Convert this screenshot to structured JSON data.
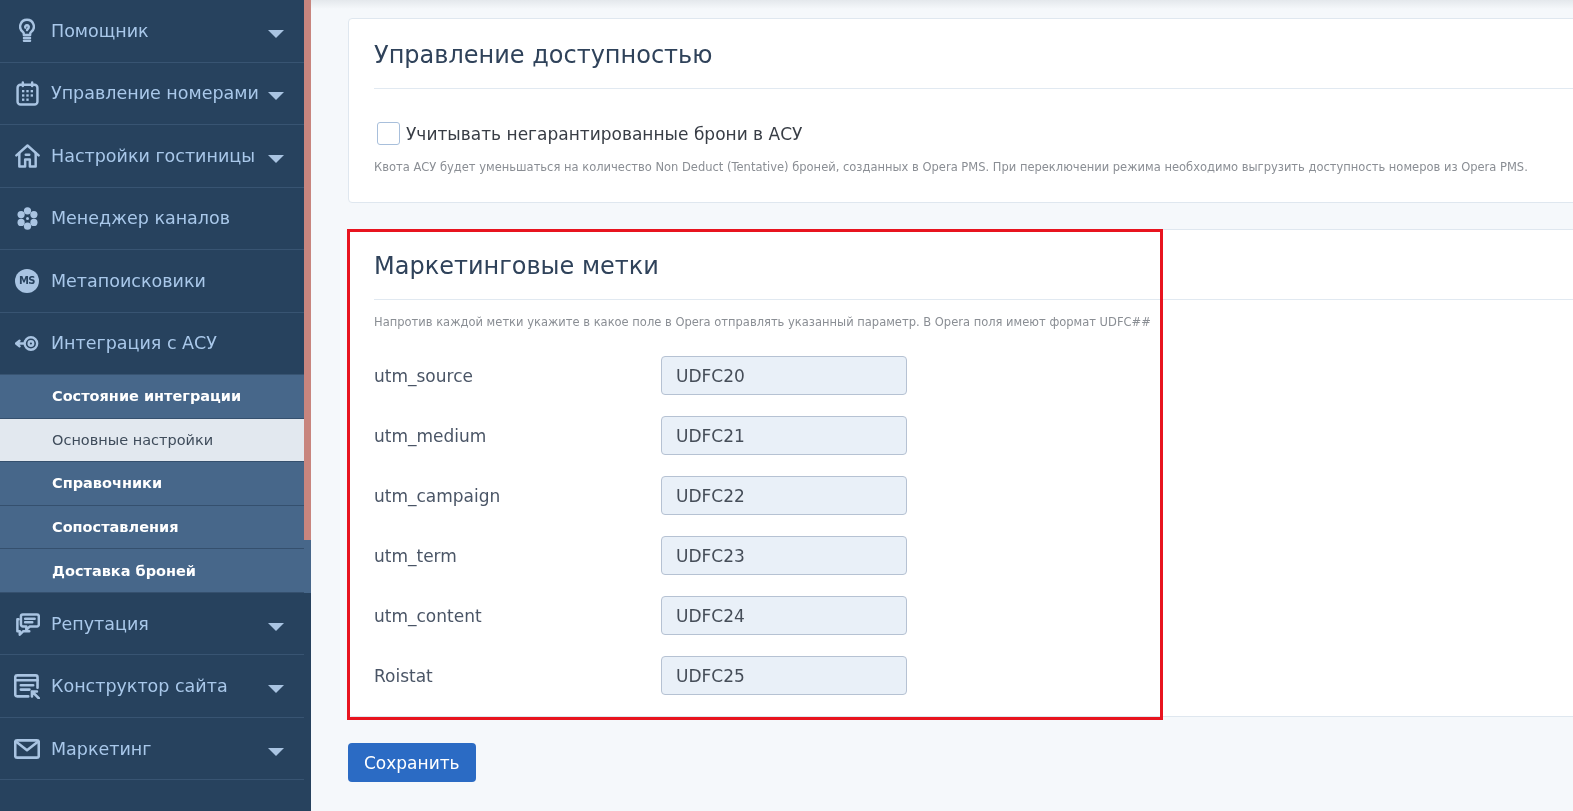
{
  "sidebar": {
    "items": [
      {
        "label": "Помощник",
        "dropdown": true
      },
      {
        "label": "Управление номерами",
        "dropdown": true
      },
      {
        "label": "Настройки гостиницы",
        "dropdown": true
      },
      {
        "label": "Менеджер каналов",
        "dropdown": false
      },
      {
        "label": "Метапоисковики",
        "badge": "MS",
        "dropdown": false
      },
      {
        "label": "Интеграция с АСУ",
        "dropdown": false,
        "children": [
          {
            "label": "Состояние интеграции",
            "selected": false
          },
          {
            "label": "Основные настройки",
            "selected": true
          },
          {
            "label": "Справочники",
            "selected": false
          },
          {
            "label": "Сопоставления",
            "selected": false
          },
          {
            "label": "Доставка броней",
            "selected": false
          }
        ]
      },
      {
        "label": "Репутация",
        "dropdown": true
      },
      {
        "label": "Конструктор сайта",
        "dropdown": true
      },
      {
        "label": "Маркетинг",
        "dropdown": true
      }
    ]
  },
  "availability": {
    "title": "Управление доступностью",
    "checkbox": {
      "label": "Учитывать негарантированные брони в АСУ",
      "checked": false
    },
    "hint": "Квота АСУ будет уменьшаться на количество Non Deduct (Tentative) броней, созданных в Opera PMS. При переключении режима необходимо выгрузить доступность номеров из Opera PMS."
  },
  "marketing_tags": {
    "title": "Маркетинговые метки",
    "hint": "Напротив каждой метки укажите в какое поле в Opera отправлять указанный параметр. В Opera поля имеют формат UDFC##",
    "fields": [
      {
        "label": "utm_source",
        "value": "UDFC20"
      },
      {
        "label": "utm_medium",
        "value": "UDFC21"
      },
      {
        "label": "utm_campaign",
        "value": "UDFC22"
      },
      {
        "label": "utm_term",
        "value": "UDFC23"
      },
      {
        "label": "utm_content",
        "value": "UDFC24"
      },
      {
        "label": "Roistat",
        "value": "UDFC25"
      }
    ]
  },
  "save_button": "Сохранить"
}
